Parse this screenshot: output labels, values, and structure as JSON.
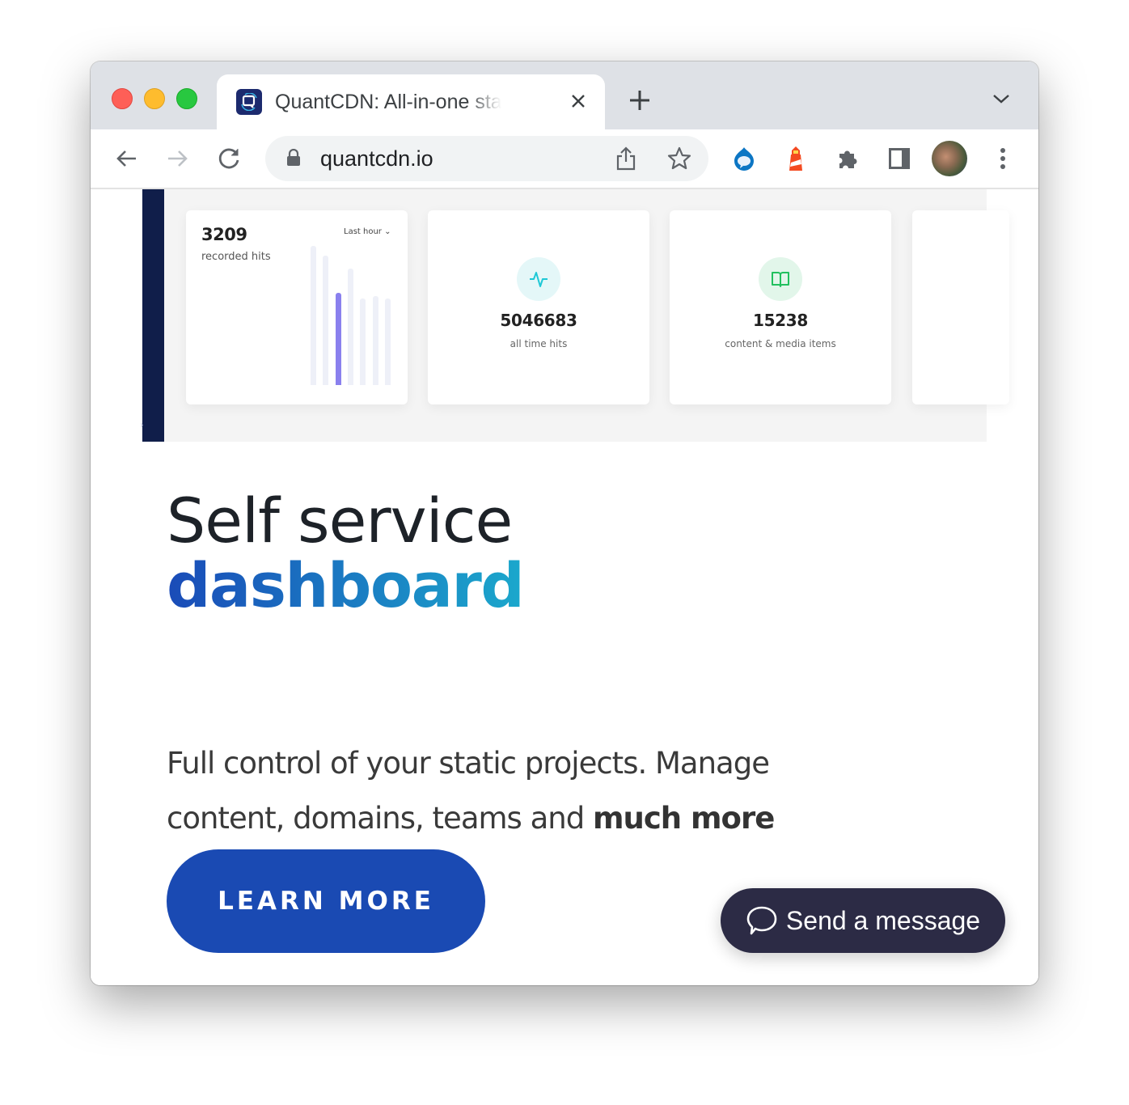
{
  "browser": {
    "tab_title": "QuantCDN: All-in-one static website hosting",
    "url": "quantcdn.io",
    "icons": [
      "back-icon",
      "forward-icon",
      "reload-icon",
      "lock-icon",
      "share-icon",
      "bookmark-star-icon",
      "drupal-extension-icon",
      "lighthouse-extension-icon",
      "extensions-puzzle-icon",
      "side-panel-icon",
      "profile-avatar",
      "more-menu-icon"
    ]
  },
  "dashboard": {
    "hits_card": {
      "value": "3209",
      "label": "recorded hits",
      "range": "Last hour",
      "bar_levels": [
        1.0,
        0.93,
        0.66,
        0.84,
        0.62,
        0.64,
        0.62
      ],
      "active_bar_index": 2
    },
    "stats": [
      {
        "value": "5046683",
        "label": "all time hits",
        "icon": "activity-pulse-icon",
        "color": "#1ec8d6",
        "bg": "#e4f7f8"
      },
      {
        "value": "15238",
        "label": "content & media items",
        "icon": "open-book-icon",
        "color": "#22c05e",
        "bg": "#e2f6ea"
      }
    ]
  },
  "hero": {
    "title_line1": "Self service",
    "title_line2": "dashboard",
    "para_plain": "Full control of your static projects. Manage content, domains, teams and ",
    "para_bold": "much more",
    "cta": "LEARN MORE"
  },
  "chat_widget": {
    "label": "Send a message"
  }
}
